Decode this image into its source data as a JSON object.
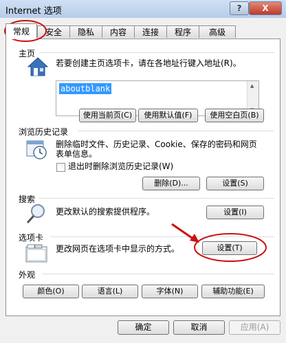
{
  "window": {
    "title": "Internet 选项",
    "help_label": "?",
    "close_label": "X"
  },
  "tabs": [
    "常规",
    "安全",
    "隐私",
    "内容",
    "连接",
    "程序",
    "高级"
  ],
  "homepage": {
    "label": "主页",
    "description": "若要创建主页选项卡，请在各地址行键入地址(R)。",
    "url": "aboutblank",
    "buttons": [
      "使用当前页(C)",
      "使用默认值(F)",
      "使用空白页(B)"
    ]
  },
  "history": {
    "label": "浏览历史记录",
    "description_line1": "删除临时文件、历史记录、Cookie、保存的密码和网页",
    "description_line2": "表单信息。",
    "checkbox_label": "退出时删除浏览历史记录(W)",
    "delete_button": "删除(D)...",
    "settings_button": "设置(S)"
  },
  "search": {
    "label": "搜索",
    "description": "更改默认的搜索提供程序。",
    "settings_button": "设置(I)"
  },
  "tabs_section": {
    "label": "选项卡",
    "description": "更改网页在选项卡中显示的方式。",
    "settings_button": "设置(T)"
  },
  "appearance": {
    "label": "外观",
    "buttons": [
      "颜色(O)",
      "语言(L)",
      "字体(N)",
      "辅助功能(E)"
    ]
  },
  "footer": {
    "ok": "确定",
    "cancel": "取消",
    "apply": "应用(A)"
  },
  "colors": {
    "annotation_red": "#cc1111",
    "selection_blue": "#3399ff"
  }
}
